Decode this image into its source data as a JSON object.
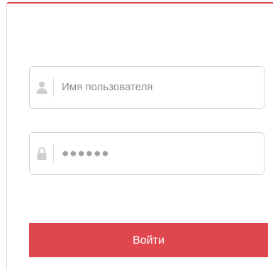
{
  "form": {
    "username": {
      "placeholder": "Имя пользователя",
      "icon": "user-icon"
    },
    "password": {
      "value_masked": "●●●●●●",
      "icon": "lock-icon"
    },
    "submit_label": "Войти"
  },
  "colors": {
    "accent": "#e0464e",
    "field_border": "#d6d6d6",
    "icon": "#cfcfcf",
    "placeholder_text": "#8c8c8c"
  }
}
